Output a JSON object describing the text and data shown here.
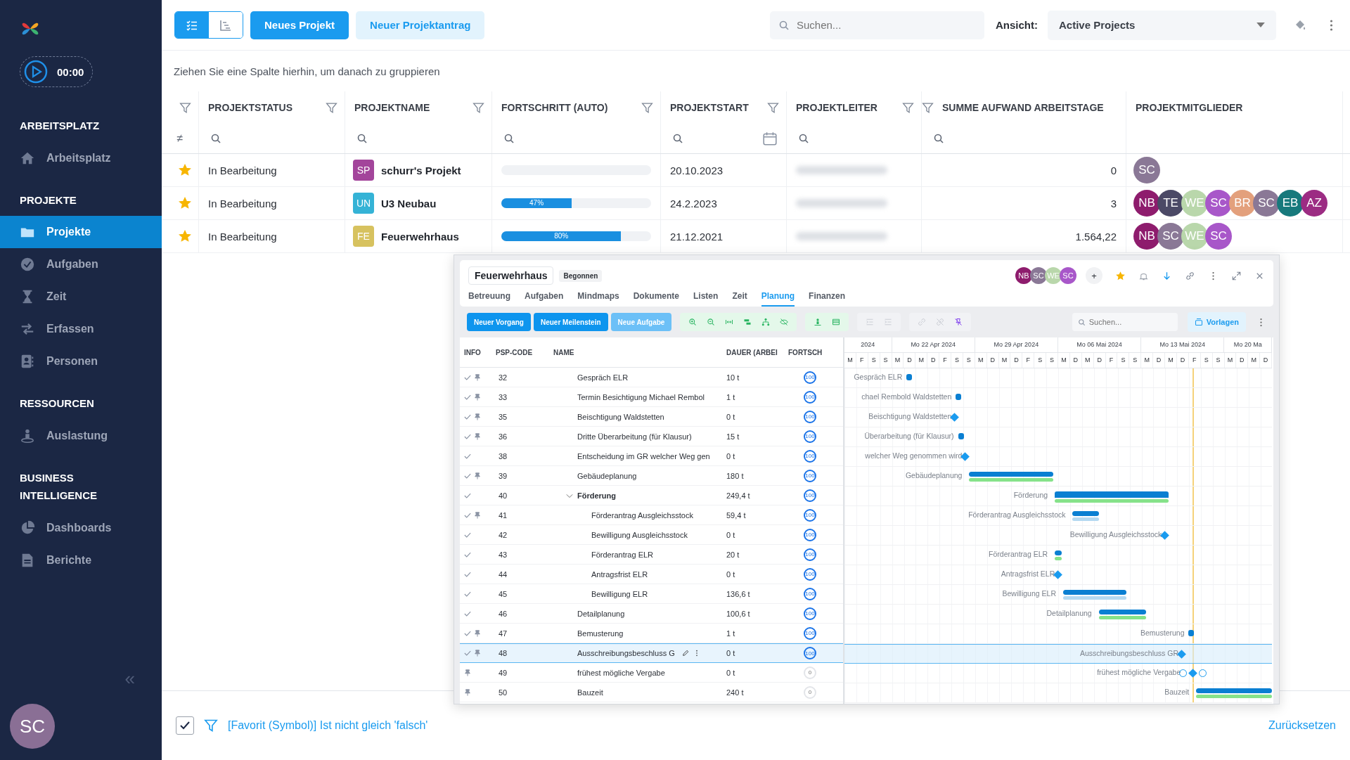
{
  "sidebar": {
    "timer": "00:00",
    "sections": [
      {
        "title": "ARBEITSPLATZ",
        "items": [
          {
            "label": "Arbeitsplatz",
            "selected": false
          }
        ]
      },
      {
        "title": "PROJEKTE",
        "items": [
          {
            "label": "Projekte",
            "selected": true
          },
          {
            "label": "Aufgaben",
            "selected": false
          },
          {
            "label": "Zeit",
            "selected": false
          },
          {
            "label": "Erfassen",
            "selected": false
          },
          {
            "label": "Personen",
            "selected": false
          }
        ]
      },
      {
        "title": "RESSOURCEN",
        "items": [
          {
            "label": "Auslastung",
            "selected": false
          }
        ]
      },
      {
        "title": "BUSINESS INTELLIGENCE",
        "items": [
          {
            "label": "Dashboards",
            "selected": false
          },
          {
            "label": "Berichte",
            "selected": false
          }
        ]
      }
    ],
    "collapse": "«",
    "user": {
      "initials": "SC",
      "color": "#8a6f95"
    }
  },
  "toolbar": {
    "view_toggles": [
      {
        "selected": true
      },
      {
        "selected": false
      }
    ],
    "buttons": [
      {
        "label": "Neues Projekt",
        "kind": "primary"
      },
      {
        "label": "Neuer Projektantrag",
        "kind": "secondary"
      }
    ],
    "search": {
      "placeholder": "Suchen..."
    },
    "view": {
      "label": "Ansicht:",
      "value": "Active Projects"
    }
  },
  "group_hint": "Ziehen Sie eine Spalte hierhin, um danach zu gruppieren",
  "table": {
    "columns": [
      {
        "kind": "favorite",
        "filter_symbol": "≠"
      },
      {
        "kind": "text",
        "label": "PROJEKTSTATUS"
      },
      {
        "kind": "project",
        "label": "PROJEKTNAME"
      },
      {
        "kind": "progress",
        "label": "FORTSCHRITT (AUTO)"
      },
      {
        "kind": "date",
        "label": "PROJEKTSTART"
      },
      {
        "kind": "person",
        "label": "PROJEKTLEITER"
      },
      {
        "kind": "number",
        "label": "SUMME AUFWAND ARBEITSTAGE"
      },
      {
        "kind": "avatars",
        "label": "PROJEKTMITGLIEDER"
      }
    ],
    "rows": [
      {
        "favorite": true,
        "status": "In Bearbeitung",
        "badge": "SP",
        "color": "#a3459b",
        "name": "schurr's Projekt",
        "level": 0,
        "start": "20.10.2023",
        "sum": "0",
        "members": [
          {
            "initials": "SC",
            "color": "#8a7896"
          }
        ]
      },
      {
        "favorite": true,
        "status": "In Bearbeitung",
        "badge": "UN",
        "color": "#35b3d6",
        "name": "U3 Neubau",
        "level": 0.47,
        "progress_label": "47%",
        "start": "24.2.2023",
        "sum": "3",
        "members": [
          {
            "initials": "NB",
            "color": "#8e1c6d"
          },
          {
            "initials": "TE",
            "color": "#4b4966"
          },
          {
            "initials": "WE",
            "color": "#b9d7ab"
          },
          {
            "initials": "SC",
            "color": "#a857c9"
          },
          {
            "initials": "BR",
            "color": "#e3a07c"
          },
          {
            "initials": "SC",
            "color": "#8a7896"
          },
          {
            "initials": "EB",
            "color": "#17797c"
          },
          {
            "initials": "AZ",
            "color": "#9c2c83"
          }
        ]
      },
      {
        "favorite": true,
        "status": "In Bearbeitung",
        "badge": "FE",
        "color": "#d7c25f",
        "name": "Feuerwehrhaus",
        "level": 0.8,
        "progress_label": "80%",
        "start": "21.12.2021",
        "sum": "1.564,22",
        "members": [
          {
            "initials": "NB",
            "color": "#8e1c6d"
          },
          {
            "initials": "SC",
            "color": "#8a7896"
          },
          {
            "initials": "WE",
            "color": "#b9d7ab"
          },
          {
            "initials": "SC",
            "color": "#a857c9"
          }
        ]
      }
    ]
  },
  "project_window": {
    "title": "Feuerwehrhaus",
    "status": "Begonnen",
    "add_member": "+",
    "members": [
      {
        "initials": "NB",
        "color": "#8e1c6d"
      },
      {
        "initials": "SC",
        "color": "#8a7896"
      },
      {
        "initials": "WE",
        "color": "#b9d7ab"
      },
      {
        "initials": "SC",
        "color": "#a857c9"
      }
    ],
    "tabs": [
      {
        "label": "Betreuung",
        "selected": false
      },
      {
        "label": "Aufgaben",
        "selected": false
      },
      {
        "label": "Mindmaps",
        "selected": false
      },
      {
        "label": "Dokumente",
        "selected": false
      },
      {
        "label": "Listen",
        "selected": false
      },
      {
        "label": "Zeit",
        "selected": false
      },
      {
        "label": "Planung",
        "selected": true
      },
      {
        "label": "Finanzen",
        "selected": false
      }
    ],
    "actions": [
      {
        "label": "Neuer Vorgang",
        "kind": "primary"
      },
      {
        "label": "Neuer Meilenstein",
        "kind": "primary"
      },
      {
        "label": "Neue Aufgabe",
        "kind": "light"
      }
    ],
    "search": {
      "placeholder": "Suchen..."
    },
    "templates_button": "Vorlagen",
    "grid": {
      "columns": [
        "INFO",
        "PSP-CODE",
        "NAME",
        "DAUER (ARBEI",
        "FORTSCH"
      ],
      "rows": [
        {
          "done": true,
          "pinned": true,
          "code": "32",
          "name": "Gespräch ELR",
          "duration": "10 t",
          "progress": "100",
          "selected": false
        },
        {
          "done": true,
          "pinned": true,
          "code": "33",
          "name": "Termin Besichtigung Michael Rembol",
          "duration": "1 t",
          "progress": "100",
          "selected": false
        },
        {
          "done": true,
          "pinned": true,
          "code": "35",
          "name": "Beischtigung Waldstetten",
          "duration": "0 t",
          "progress": "100",
          "selected": false
        },
        {
          "done": true,
          "pinned": true,
          "code": "36",
          "name": "Dritte Überarbeitung (für Klausur)",
          "duration": "15 t",
          "progress": "100",
          "selected": false
        },
        {
          "done": true,
          "pinned": false,
          "code": "38",
          "name": "Entscheidung im GR welcher Weg gen",
          "duration": "0 t",
          "progress": "100",
          "selected": false
        },
        {
          "done": true,
          "pinned": true,
          "code": "39",
          "name": "Gebäudeplanung",
          "duration": "180 t",
          "progress": "100",
          "selected": false
        },
        {
          "done": true,
          "pinned": false,
          "code": "40",
          "name": "Förderung",
          "duration": "249,4 t",
          "progress": "100",
          "selected": false,
          "expanded": true,
          "children": [
            {
              "done": true,
              "pinned": true,
              "code": "41",
              "name": "Förderantrag Ausgleichsstock",
              "duration": "59,4 t",
              "progress": "100",
              "selected": false
            },
            {
              "done": true,
              "pinned": false,
              "code": "42",
              "name": "Bewilligung Ausgleichsstock",
              "duration": "0 t",
              "progress": "100",
              "selected": false
            },
            {
              "done": true,
              "pinned": false,
              "code": "43",
              "name": "Förderantrag ELR",
              "duration": "20 t",
              "progress": "100",
              "selected": false
            },
            {
              "done": true,
              "pinned": false,
              "code": "44",
              "name": "Antragsfrist ELR",
              "duration": "0 t",
              "progress": "100",
              "selected": false
            },
            {
              "done": true,
              "pinned": false,
              "code": "45",
              "name": "Bewilligung ELR",
              "duration": "136,6 t",
              "progress": "100",
              "selected": false
            }
          ]
        },
        {
          "done": true,
          "pinned": false,
          "code": "46",
          "name": "Detailplanung",
          "duration": "100,6 t",
          "progress": "100",
          "selected": false
        },
        {
          "done": true,
          "pinned": true,
          "code": "47",
          "name": "Bemusterung",
          "duration": "1 t",
          "progress": "100",
          "selected": false
        },
        {
          "done": true,
          "pinned": true,
          "code": "48",
          "name": "Ausschreibungsbeschluss G",
          "duration": "0 t",
          "progress": "100",
          "selected": true
        },
        {
          "done": false,
          "pinned": true,
          "code": "49",
          "name": "frühest mögliche Vergabe",
          "duration": "0 t",
          "progress": "0",
          "selected": false
        },
        {
          "done": false,
          "pinned": true,
          "code": "50",
          "name": "Bauzeit",
          "duration": "240 t",
          "progress": "0",
          "selected": false
        }
      ]
    },
    "gantt": {
      "weeks": [
        "2024",
        "Mo 22 Apr 2024",
        "Mo 29 Apr 2024",
        "Mo 06 Mai 2024",
        "Mo 13 Mai 2024",
        "Mo 20 Ma"
      ],
      "days": [
        "M",
        "F",
        "S",
        "S",
        "M",
        "D",
        "M",
        "D",
        "F",
        "S",
        "S",
        "M",
        "D",
        "M",
        "D",
        "F",
        "S",
        "S",
        "M",
        "D",
        "M",
        "D",
        "F",
        "S",
        "S",
        "M",
        "D",
        "M",
        "D",
        "F",
        "S",
        "S",
        "M",
        "D",
        "M",
        "D"
      ],
      "rows": [
        {
          "label": "Gespräch ELR",
          "kind": "point",
          "selected": false
        },
        {
          "label": "chael Rembold Waldstetten",
          "kind": "point",
          "selected": false
        },
        {
          "label": "Beischtigung Waldstetten",
          "kind": "milestone",
          "selected": false
        },
        {
          "label": "Überarbeitung (für Klausur)",
          "kind": "point",
          "selected": false
        },
        {
          "label": "welcher Weg genommen wird",
          "kind": "milestone",
          "selected": false
        },
        {
          "label": "Gebäudeplanung",
          "kind": "task",
          "selected": false
        },
        {
          "label": "Förderung",
          "kind": "summary",
          "selected": false
        },
        {
          "label": "Förderantrag Ausgleichsstock",
          "kind": "task",
          "selected": false
        },
        {
          "label": "Bewilligung Ausgleichsstock",
          "kind": "milestone",
          "selected": false
        },
        {
          "label": "Förderantrag ELR",
          "kind": "task",
          "selected": false
        },
        {
          "label": "Antragsfrist ELR",
          "kind": "milestone",
          "selected": false
        },
        {
          "label": "Bewilligung ELR",
          "kind": "task",
          "selected": false
        },
        {
          "label": "Detailplanung",
          "kind": "task",
          "selected": false
        },
        {
          "label": "Bemusterung",
          "kind": "point",
          "selected": false
        },
        {
          "label": "Ausschreibungsbeschluss GR",
          "kind": "milestone",
          "selected": true
        },
        {
          "label": "frühest mögliche Vergabe",
          "kind": "milestone",
          "selected": false
        },
        {
          "label": "Bauzeit",
          "kind": "task",
          "selected": false
        }
      ]
    }
  },
  "filter_bar": {
    "checked": true,
    "text": "[Favorit (Symbol)] Ist nicht gleich 'falsch'",
    "reset": "Zurücksetzen"
  }
}
